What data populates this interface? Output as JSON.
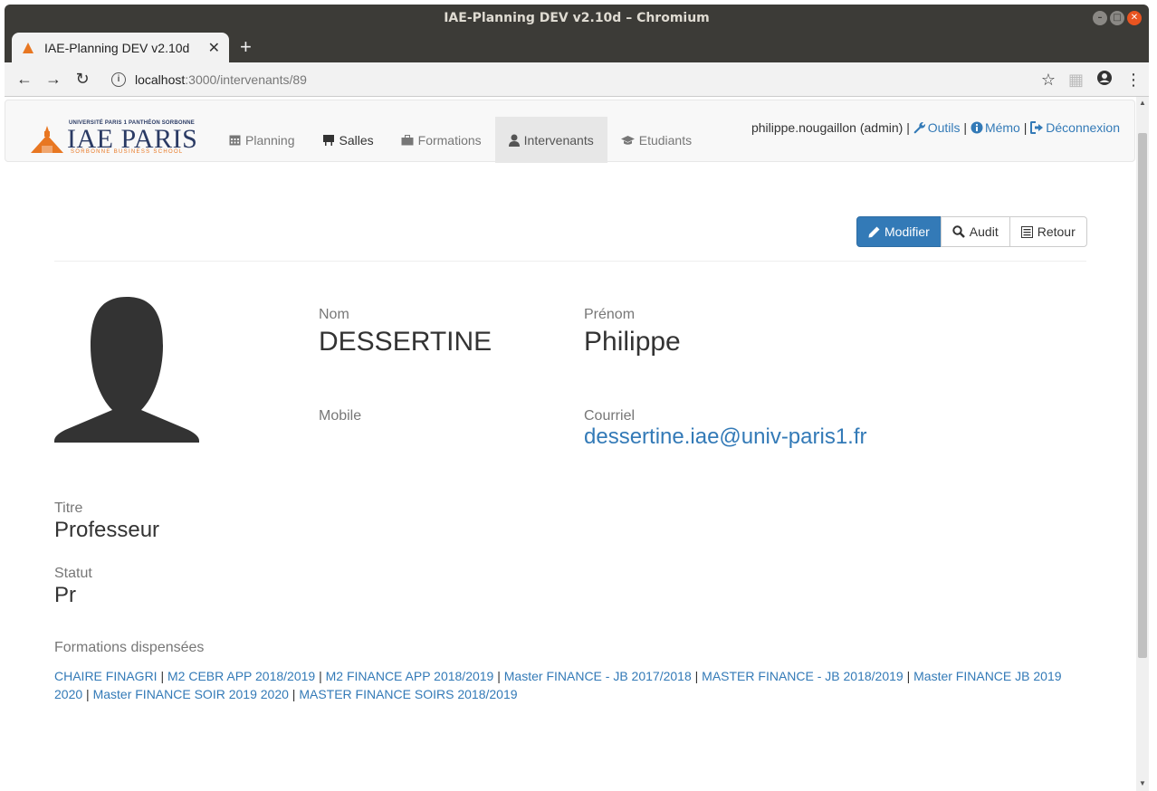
{
  "window": {
    "title": "IAE-Planning DEV v2.10d – Chromium",
    "tab_title": "IAE-Planning DEV v2.10d",
    "url_host": "localhost",
    "url_path": ":3000/intervenants/89"
  },
  "brand": {
    "university": "UNIVERSITÉ PARIS 1 PANTHÉON SORBONNE",
    "name": "IAE PARIS",
    "school": "SORBONNE BUSINESS SCHOOL",
    "colors": {
      "navy": "#2a3a64",
      "orange": "#e87722"
    }
  },
  "nav": {
    "items": [
      {
        "label": "Planning",
        "icon": "calendar-icon"
      },
      {
        "label": "Salles",
        "icon": "blackboard-icon"
      },
      {
        "label": "Formations",
        "icon": "briefcase-icon"
      },
      {
        "label": "Intervenants",
        "icon": "user-icon",
        "active": true
      },
      {
        "label": "Etudiants",
        "icon": "graduation-cap-icon"
      }
    ]
  },
  "user": {
    "name": "philippe.nougaillon (admin)",
    "sep": "|",
    "outils": "Outils",
    "memo": "Mémo",
    "logout": "Déconnexion"
  },
  "actions": {
    "edit": "Modifier",
    "audit": "Audit",
    "back": "Retour"
  },
  "profile": {
    "nom_label": "Nom",
    "nom": "DESSERTINE",
    "prenom_label": "Prénom",
    "prenom": "Philippe",
    "mobile_label": "Mobile",
    "mobile": "",
    "courriel_label": "Courriel",
    "courriel": "dessertine.iae@univ-paris1.fr",
    "titre_label": "Titre",
    "titre": "Professeur",
    "statut_label": "Statut",
    "statut": "Pr",
    "formations_label": "Formations dispensées",
    "formations": [
      "CHAIRE FINAGRI",
      "M2 CEBR APP 2018/2019",
      "M2 FINANCE APP 2018/2019",
      "Master FINANCE - JB 2017/2018",
      "MASTER FINANCE - JB 2018/2019",
      "Master FINANCE JB 2019 2020",
      "Master FINANCE SOIR 2019 2020",
      "MASTER FINANCE SOIRS 2018/2019"
    ]
  },
  "colors": {
    "link": "#337ab7",
    "primary": "#337ab7"
  }
}
